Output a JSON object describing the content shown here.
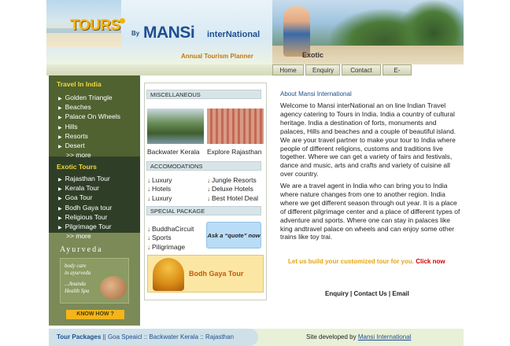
{
  "header": {
    "tours_logo": "TOURS",
    "by": "By",
    "brand_name": "MANSi",
    "brand_suffix": "interNational",
    "tagline": "Annual Tourism Planner",
    "photo_caption": "Exotic"
  },
  "nav": {
    "items": [
      "Home",
      "Enquiry",
      "Contact Us",
      "E-mail"
    ]
  },
  "sidebar": {
    "travel_title": "Travel In India",
    "travel_items": [
      "Golden Triangle",
      "Beaches",
      "Palace On Wheels",
      "Hills",
      "Resorts",
      "Desert"
    ],
    "travel_more": ">> more",
    "exotic_title": "Exotic Tours",
    "exotic_items": [
      "Rajasthan Tour",
      "Kerala Tour",
      "Goa Tour",
      "Bodh Gaya tour",
      "Religious Tour",
      "Pilgrimage Tour"
    ],
    "exotic_more": ">> more",
    "ayurveda_title": "Ayurveda",
    "ayurveda_text": [
      "body care",
      "in ayurveda",
      "...Ananda",
      "Health Spa"
    ],
    "know_how": "KNOW HOW ?"
  },
  "middle": {
    "misc_title": "MISCELLANEOUS",
    "caption_kerala": "Backwater Kerala",
    "caption_raj": "Explore Rajasthan",
    "accom_title": "ACCOMODATIONS",
    "accom_left": [
      "Luxury",
      "Hotels",
      "Luxury"
    ],
    "accom_right": [
      "Jungle Resorts",
      "Deluxe Hotels",
      "Best Hotel Deal"
    ],
    "special_title": "SPECIAL PACKAGE",
    "special_items": [
      "BuddhaCircuit",
      "Sports",
      "Piligrimage"
    ],
    "quote_btn": "Ask a “quote” now",
    "bodh_title": "Bodh Gaya Tour"
  },
  "main": {
    "about_title": "About Mansi International",
    "p1": "Welcome to Mansi interNational an on line Indian Travel agency catering to Tours in India. India a country of cultural heritage. India a destination of forts, monuments and palaces, Hills and beaches and a couple of beautiful island. We are your travel partner to make your tour to India where people of different religions, customs and traditions live together. Where we can get a variety of fairs and festivals, dance and music, arts and crafts and variety of cuisine all over country.",
    "p2": "We are a travel agent in India who can bring you to India where nature changes from one to another region. India where we get different season through out year. It is a place of different pilgrimage center and a place of different types of adventure and sports. Where one can stay in palaces like king andtravel palace on wheels and can enjoy some other trains like toy trai.",
    "cta_text": "Let us build your customized tour for you. ",
    "cta_link": "Click now",
    "link_enquiry": "Enquiry",
    "link_contact": "Contact Us",
    "link_email": "Email",
    "separator": " | "
  },
  "footer": {
    "packages_label": "Tour Packages",
    "packages": "|| Goa Speaicl :: Backwater Kerala :: Rajasthan",
    "dev_text": "Site developed by ",
    "dev_link": "Mansi International"
  }
}
